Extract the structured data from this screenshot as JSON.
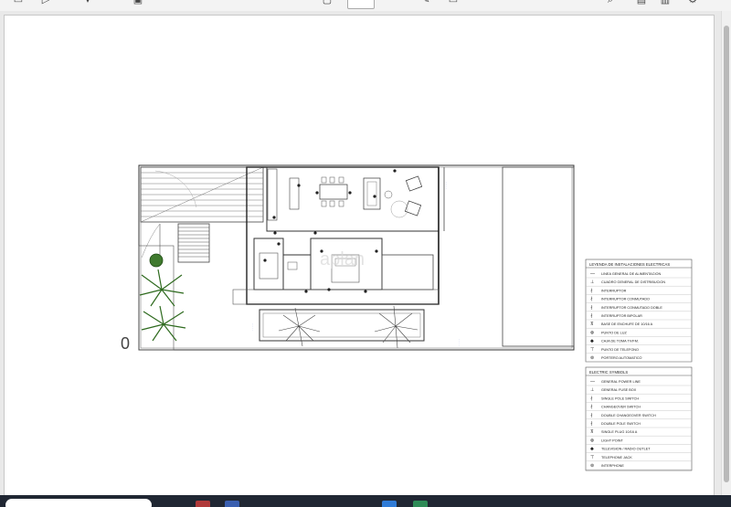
{
  "toolbar": {
    "page_number": "",
    "page_count": "",
    "icons": [
      "sidebar-icon",
      "pointer-icon",
      "chevron-down-icon",
      "save-icon",
      "page-icon",
      "draw-icon",
      "comment-icon",
      "search-icon",
      "print-icon",
      "download-icon",
      "settings-icon"
    ]
  },
  "plan": {
    "zero_label": "0",
    "watermark": "aplan",
    "legend_es": {
      "title": "LEYENDA DE INSTALACIONES ELECTRICAS",
      "items": [
        "LINEA GENERAL DE ALIMENTACION",
        "CUADRO GENERAL DE DISTRIBUCION",
        "INTERRUPTOR",
        "INTERRUPTOR CONMUTADO",
        "INTERRUPTOR CONMUTADO DOBLE",
        "INTERRUPTOR BIPOLAR",
        "BASE DE ENCHUFE DE 10/16 A",
        "PUNTO DE LUZ",
        "CAJA DE TOMA TV/FM.",
        "PUNTO DE TELEFONO",
        "PORTERO AUTOMATICO"
      ]
    },
    "legend_en": {
      "title": "ELECTRIC SYMBOLS",
      "items": [
        "GENERAL POWER LINE",
        "GENERAL FUSE BOX",
        "SINGLE POLE SWITCH",
        "CHANGEOVER SWITCH",
        "DOUBLE CHANGEOVER SWITCH",
        "DOUBLE POLE SWITCH",
        "SINGLE PLUG 10/16 A",
        "LIGHT POINT",
        "TELEVISION / RADIO OUTLET",
        "TELEPHONE JACK",
        "INTERPHONE"
      ]
    }
  },
  "taskbar": {
    "clock": ""
  }
}
